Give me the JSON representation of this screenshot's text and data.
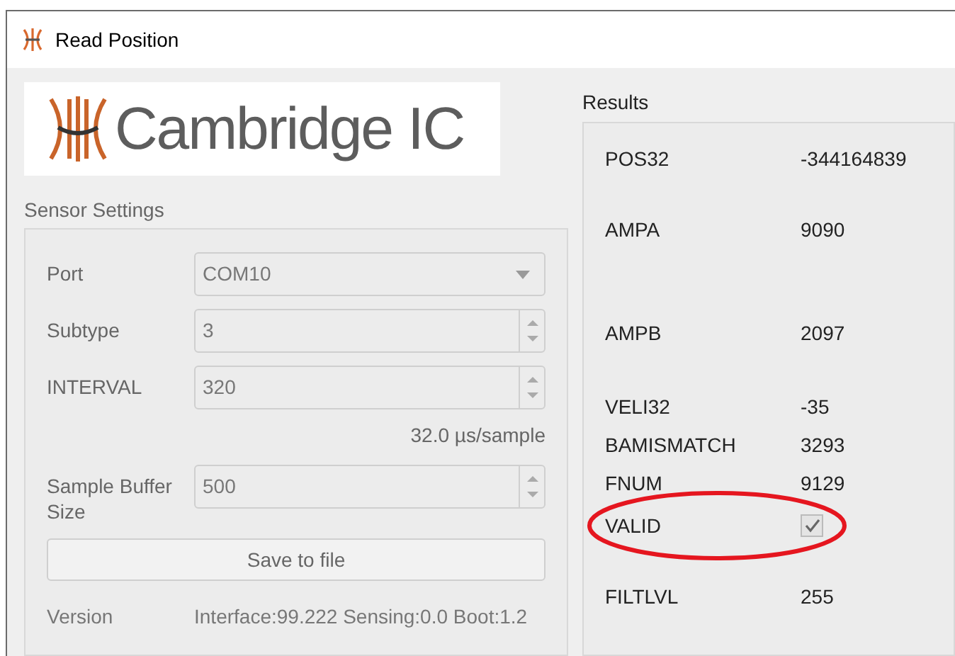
{
  "window": {
    "title": "Read Position"
  },
  "logo": {
    "text": "Cambridge IC"
  },
  "sensor_settings": {
    "title": "Sensor Settings",
    "fields": [
      {
        "kind": "dropdown",
        "label": "Port",
        "value": "COM10"
      },
      {
        "kind": "spinner",
        "label": "Subtype",
        "value": "3"
      },
      {
        "kind": "spinner",
        "label": "INTERVAL",
        "value": "320"
      },
      {
        "kind": "note",
        "text": "32.0 µs/sample"
      },
      {
        "kind": "spinner",
        "label": "Sample Buffer Size",
        "value": "500"
      }
    ],
    "save_button": "Save to file",
    "version": {
      "label": "Version",
      "value": "Interface:99.222 Sensing:0.0 Boot:1.2"
    }
  },
  "results": {
    "title": "Results",
    "rows": [
      {
        "kind": "text",
        "label": "POS32",
        "value": "-344164839",
        "highlighted": false
      },
      {
        "kind": "text",
        "label": "AMPA",
        "value": "9090",
        "highlighted": false
      },
      {
        "kind": "text",
        "label": "AMPB",
        "value": "2097",
        "highlighted": false
      },
      {
        "kind": "text",
        "label": "VELI32",
        "value": "-35",
        "highlighted": false
      },
      {
        "kind": "text",
        "label": "BAMISMATCH",
        "value": "3293",
        "highlighted": false
      },
      {
        "kind": "text",
        "label": "FNUM",
        "value": "9129",
        "highlighted": false
      },
      {
        "kind": "checkbox",
        "label": "VALID",
        "checked": true,
        "highlighted": true
      },
      {
        "kind": "text",
        "label": "FILTLVL",
        "value": "255",
        "highlighted": false
      }
    ]
  }
}
